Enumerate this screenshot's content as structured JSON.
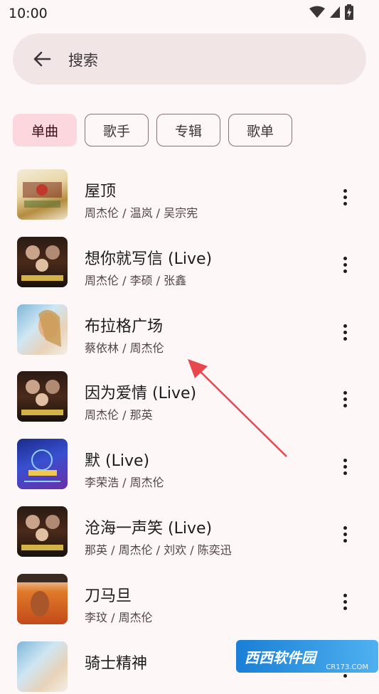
{
  "status_bar": {
    "time": "10:00"
  },
  "search": {
    "placeholder": "搜索"
  },
  "filters": [
    {
      "label": "单曲",
      "active": true
    },
    {
      "label": "歌手",
      "active": false
    },
    {
      "label": "专辑",
      "active": false
    },
    {
      "label": "歌单",
      "active": false
    }
  ],
  "songs": [
    {
      "title": "屋顶",
      "artist": "周杰伦 / 温岚 / 吴宗宪"
    },
    {
      "title": "想你就写信 (Live)",
      "artist": "周杰伦 / 李硕 / 张鑫"
    },
    {
      "title": "布拉格广场",
      "artist": "蔡依林 / 周杰伦"
    },
    {
      "title": "因为爱情 (Live)",
      "artist": "周杰伦 / 那英"
    },
    {
      "title": "默 (Live)",
      "artist": "李荣浩 / 周杰伦"
    },
    {
      "title": "沧海一声笑 (Live)",
      "artist": "那英 / 周杰伦 / 刘欢 / 陈奕迅"
    },
    {
      "title": "刀马旦",
      "artist": "李玟 / 周杰伦"
    },
    {
      "title": "骑士精神",
      "artist": ""
    }
  ],
  "watermark": {
    "text": "西西软件园",
    "sub": "CR173.COM"
  },
  "colors": {
    "accent_chip": "#fcd8de",
    "search_bg": "#f2e5e6",
    "background": "#fdf7f8",
    "annotation_arrow": "#e8474e"
  }
}
